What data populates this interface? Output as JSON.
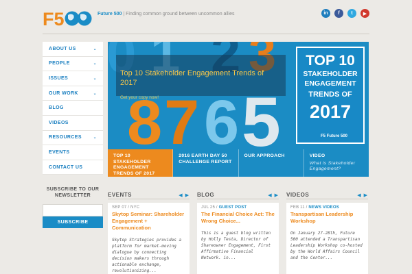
{
  "header": {
    "logo_text": "F500",
    "brand_name": "Future 500",
    "separator": "|",
    "tagline": "Finding common ground between uncommon allies",
    "social": [
      {
        "name": "linkedin-icon",
        "glyph": "in"
      },
      {
        "name": "facebook-icon",
        "glyph": "f"
      },
      {
        "name": "twitter-icon",
        "glyph": "t"
      },
      {
        "name": "youtube-icon",
        "glyph": "▶"
      }
    ]
  },
  "nav": {
    "items": [
      {
        "label": "ABOUT US",
        "chev": "⌄"
      },
      {
        "label": "PEOPLE",
        "chev": "⌄"
      },
      {
        "label": "ISSUES",
        "chev": "⌄"
      },
      {
        "label": "OUR WORK",
        "chev": "⌄"
      },
      {
        "label": "BLOG",
        "chev": ""
      },
      {
        "label": "VIDEOS",
        "chev": ""
      },
      {
        "label": "RESOURCES",
        "chev": "⌄"
      },
      {
        "label": "EVENTS",
        "chev": ""
      },
      {
        "label": "CONTACT US",
        "chev": ""
      }
    ]
  },
  "subscribe": {
    "title": "SUBSCRIBE TO OUR NEWSLETTER",
    "input_placeholder": "",
    "button_label": "SUBSCRIBE"
  },
  "hero": {
    "headline": "Top 10 Stakeholder Engagement Trends of 2017",
    "cta": "Get your copy now!",
    "card": {
      "line1": "TOP 10",
      "line2": "STAKEHOLDER",
      "line3": "ENGAGEMENT",
      "line4": "TRENDS OF",
      "line5": "2017",
      "logo": "F5 Future 500"
    },
    "numbers": [
      "0",
      "1",
      "2",
      "3",
      "8",
      "7",
      "6",
      "5"
    ]
  },
  "tabs": [
    {
      "label": "TOP 10 STAKEHOLDER ENGAGEMENT TRENDS OF 2017",
      "sub": "",
      "active": true
    },
    {
      "label": "2016 EARTH DAY 50 CHALLENGE REPORT",
      "sub": "",
      "active": false
    },
    {
      "label": "OUR APPROACH",
      "sub": "",
      "active": false
    },
    {
      "label": "VIDEO",
      "sub": "What is Stakeholder Engagement?",
      "active": false
    }
  ],
  "columns": [
    {
      "heading": "EVENTS",
      "arrows": "◀ ▶",
      "meta": "SEP 07 / NYC",
      "meta_tag": "",
      "title": "Skytop Seminar: Shareholder Engagement + Communication",
      "body": "Skytop Strategies provides a platform for market-moving dialogue by connecting decision makers through actionable exchange, revolutionizing..."
    },
    {
      "heading": "BLOG",
      "arrows": "◀ ▶",
      "meta": "JUL 25 /",
      "meta_tag": "GUEST POST",
      "title": "The Financial Choice Act: The Wrong Choice...",
      "body": "This is a guest blog written by Holly Testa, Director of Shareowner Engagement, First Affirmative Financial Network. in..."
    },
    {
      "heading": "VIDEOS",
      "arrows": "◀ ▶",
      "meta": "FEB 11 /",
      "meta_tag": "NEWS VIDEOS",
      "title": "Transpartisan Leadership Workshop",
      "body": "On January 27-28th, Future 500 attended a Transpartisan Leadership Workshop co-hosted by the World Affairs Council and the Center..."
    }
  ],
  "colors": {
    "blue": "#1a8cc6",
    "orange": "#ed8a1e",
    "yellow": "#f4c64a"
  }
}
